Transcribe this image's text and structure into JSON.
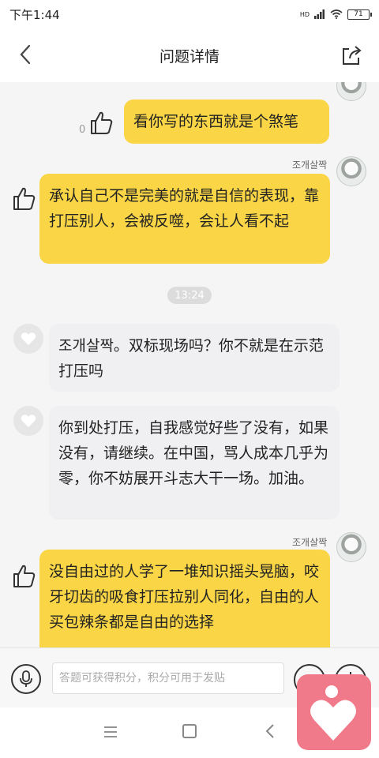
{
  "status_bar": {
    "time": "下午1:44",
    "network": "HD",
    "battery": "71"
  },
  "header": {
    "title": "问题详情"
  },
  "messages": [
    {
      "text": "看你写的东西就是个煞笔",
      "likes": "0"
    },
    {
      "author": "조개살짝",
      "text": "承认自己不是完美的就是自信的表现，靠打压别人，会被反噬，会让人看不起"
    },
    {
      "text": "조개살짝。双标现场吗？你不就是在示范打压吗"
    },
    {
      "text": "你到处打压，自我感觉好些了没有，如果没有，请继续。在中国，骂人成本几乎为零，你不妨展开斗志大干一场。加油。"
    },
    {
      "author": "조개살짝",
      "text": "没自由过的人学了一堆知识摇头晃脑，咬牙切齿的吸食打压拉别人同化，自由的人买包辣条都是自由的选择"
    }
  ],
  "time_divider": "13:24",
  "input": {
    "placeholder": "答题可获得积分，积分可用于发贴"
  },
  "colors": {
    "accent": "#fad646",
    "received_bubble": "#f0f0f2",
    "float_app": "#f07a8a"
  }
}
